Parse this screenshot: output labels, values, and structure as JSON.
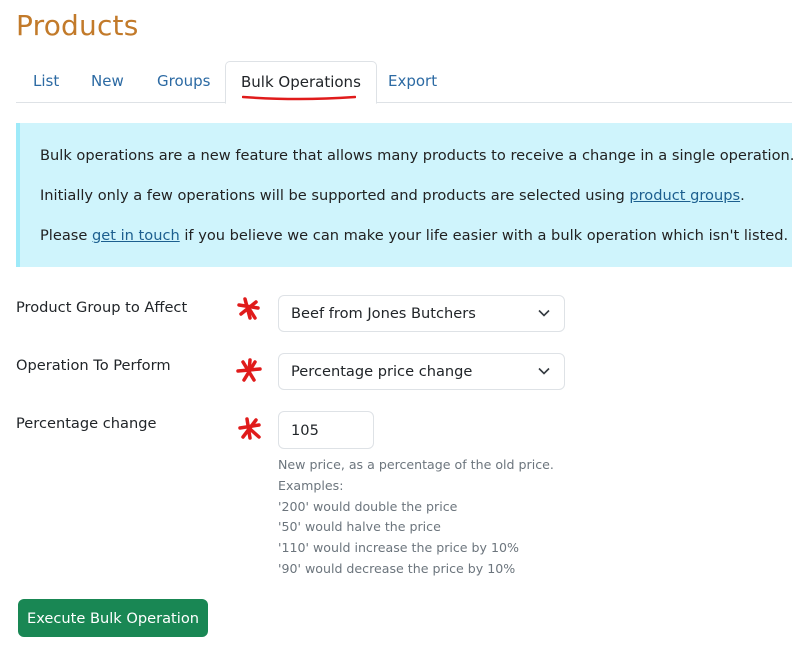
{
  "page": {
    "title": "Products"
  },
  "tabs": [
    {
      "label": "List",
      "active": false
    },
    {
      "label": "New",
      "active": false
    },
    {
      "label": "Groups",
      "active": false
    },
    {
      "label": "Bulk Operations",
      "active": true
    },
    {
      "label": "Export",
      "active": false
    }
  ],
  "info": {
    "line1": "Bulk operations are a new feature that allows many products to receive a change in a single operation.",
    "line2_pre": "Initially only a few operations will be supported and products are selected using ",
    "line2_link": "product groups",
    "line2_post": ".",
    "line3_pre": "Please ",
    "line3_link": "get in touch",
    "line3_post": " if you believe we can make your life easier with a bulk operation which isn't listed."
  },
  "form": {
    "product_group": {
      "label": "Product Group to Affect",
      "value": "Beef from Jones Butchers"
    },
    "operation": {
      "label": "Operation To Perform",
      "value": "Percentage price change"
    },
    "percentage": {
      "label": "Percentage change",
      "value": "105",
      "help": [
        "New price, as a percentage of the old price.",
        "Examples:",
        "'200' would double the price",
        "'50' would halve the price",
        "'110' would increase the price by 10%",
        "'90' would decrease the price by 10%"
      ]
    },
    "submit_label": "Execute Bulk Operation"
  },
  "colors": {
    "title": "#c27a2a",
    "link": "#2c6aa3",
    "alert_bg": "#cff4fc",
    "button_bg": "#198754",
    "annotation_red": "#e01b1b"
  }
}
